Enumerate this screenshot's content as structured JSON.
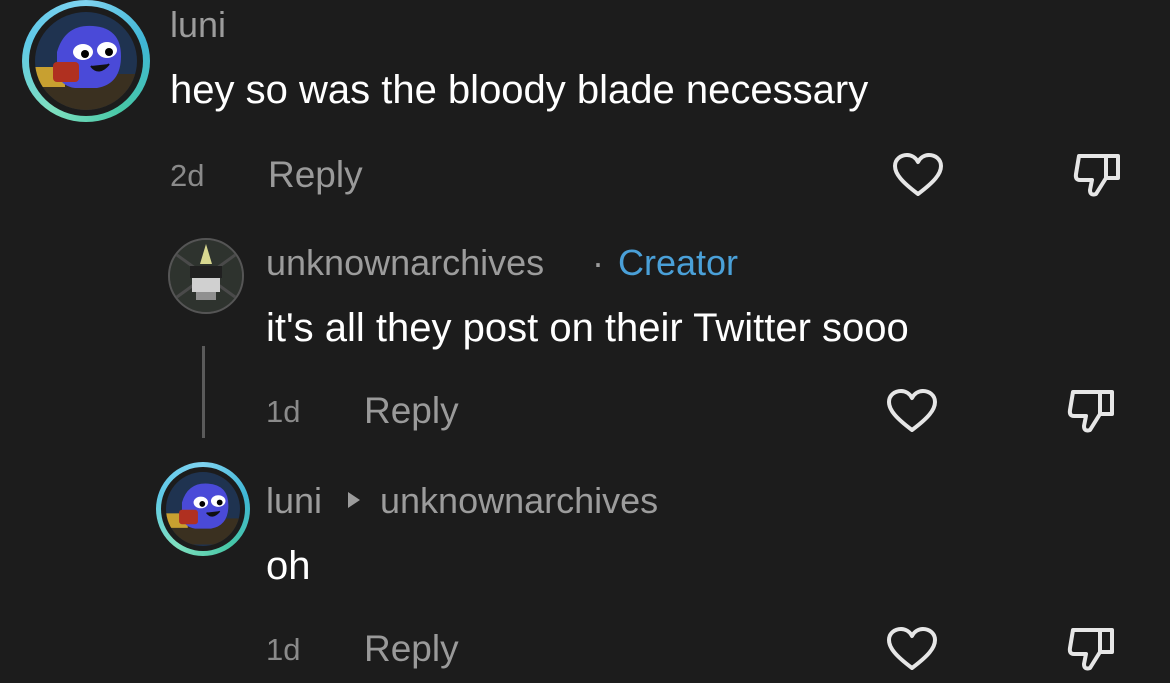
{
  "comments": [
    {
      "username": "luni",
      "text": "hey so was the bloody blade necessary",
      "time": "2d",
      "reply_label": "Reply",
      "like_icon": "heart-outline-icon",
      "dislike_icon": "thumbs-down-icon"
    },
    {
      "username": "unknownarchives",
      "separator": "·",
      "badge": "Creator",
      "text": "it's all they post on their Twitter sooo",
      "time": "1d",
      "reply_label": "Reply",
      "like_icon": "heart-outline-icon",
      "dislike_icon": "thumbs-down-icon"
    },
    {
      "username": "luni",
      "reply_to": "unknownarchives",
      "text": "oh",
      "time": "1d",
      "reply_label": "Reply",
      "like_icon": "heart-outline-icon",
      "dislike_icon": "thumbs-down-icon"
    }
  ],
  "colors": {
    "background": "#1c1c1c",
    "creator_badge": "#4aa0d8",
    "avatar_ring": "#3fb6d6"
  }
}
